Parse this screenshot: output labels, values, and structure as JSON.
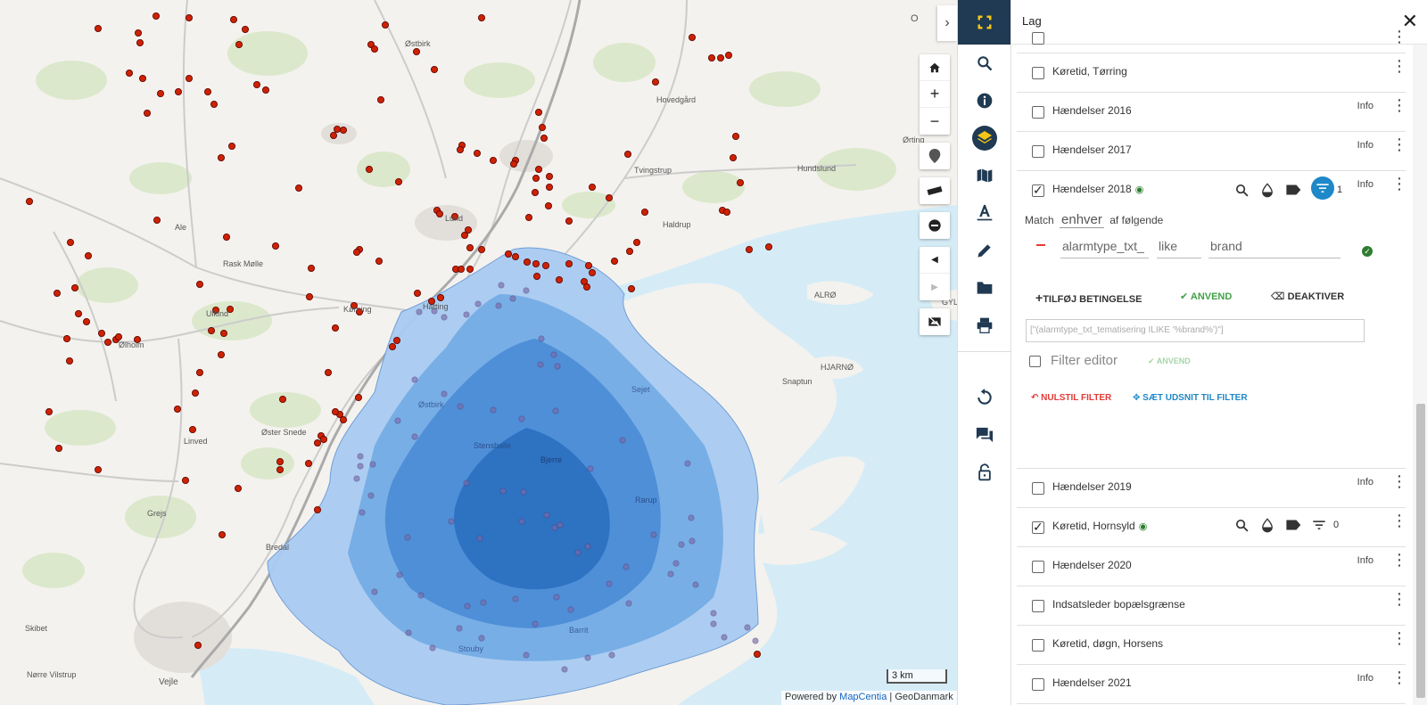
{
  "map": {
    "labels": [
      {
        "text": "Østbirk"
      },
      {
        "text": "Hovedgård"
      },
      {
        "text": "Ørting"
      },
      {
        "text": "Tvingstrup"
      },
      {
        "text": "Hundslund"
      },
      {
        "text": "Ale"
      },
      {
        "text": "Lund"
      },
      {
        "text": "Haldrup"
      },
      {
        "text": "Rask Mølle"
      },
      {
        "text": "Kørning"
      },
      {
        "text": "Hatting"
      },
      {
        "text": "Ulkind"
      },
      {
        "text": "Ølholm"
      },
      {
        "text": "ALRØ"
      },
      {
        "text": "HJARNØ"
      },
      {
        "text": "Snaptun"
      },
      {
        "text": "Linved"
      },
      {
        "text": "Øster Snede"
      },
      {
        "text": "Østbirk"
      },
      {
        "text": "Stensballe"
      },
      {
        "text": "Bjerre"
      },
      {
        "text": "Sejet"
      },
      {
        "text": "Rarup"
      },
      {
        "text": "Grejs"
      },
      {
        "text": "Bredal"
      },
      {
        "text": "Skibet"
      },
      {
        "text": "Vejle"
      },
      {
        "text": "Nørre Vilstrup"
      },
      {
        "text": "Barrit"
      },
      {
        "text": "Stouby"
      },
      {
        "text": "GYL"
      }
    ],
    "scalebar": "3 km",
    "attribution": {
      "prefix": "Powered by",
      "link": "MapCentia",
      "suffix": "| GeoDanmark"
    },
    "controls": {
      "home": "home-icon",
      "zoom_in": "+",
      "zoom_out": "−"
    },
    "colors": {
      "incident": "#cc2200",
      "drive_time_dark": "#2a6fc0",
      "drive_time_light": "#a9ccf2",
      "water": "#d5ecf7"
    }
  },
  "rail": {
    "icons": [
      "fullscreen-icon",
      "search-icon",
      "info-icon",
      "layers-icon",
      "map-icon",
      "text-icon",
      "pencil-icon",
      "folder-icon",
      "print-icon",
      "undo-icon",
      "chat-icon",
      "lock-icon"
    ]
  },
  "panel": {
    "title": "Lag",
    "layers_top": [
      {
        "name": "Køretid, Tørring",
        "info": "",
        "checked": false
      },
      {
        "name": "Hændelser 2016",
        "info": "Info",
        "checked": false
      },
      {
        "name": "Hændelser 2017",
        "info": "Info",
        "checked": false
      }
    ],
    "active_layer": {
      "name": "Hændelser 2018",
      "info": "Info",
      "checked": true,
      "filter_count": "1"
    },
    "filter": {
      "match_prefix": "Match",
      "match_value": "enhver",
      "match_suffix": "af følgende",
      "field": "alarmtype_txt_",
      "operator": "like",
      "value": "brand",
      "add_condition": "TILFØJ BETINGELSE",
      "apply": "ANVEND",
      "deactivate": "DEAKTIVER",
      "sql": "[\"(alarmtype_txt_tematisering ILIKE '%brand%')\"]",
      "filter_editor": "Filter editor",
      "editor_apply": "ANVEND",
      "reset": "NULSTIL FILTER",
      "set_extent": "SÆT UDSNIT TIL FILTER"
    },
    "layers_bottom": [
      {
        "name": "Hændelser 2019",
        "info": "Info",
        "checked": false
      }
    ],
    "hornsyld": {
      "name": "Køretid, Hornsyld",
      "checked": true,
      "filter_count": "0"
    },
    "layers_end": [
      {
        "name": "Hændelser 2020",
        "info": "Info",
        "checked": false
      },
      {
        "name": "Indsatsleder bopælsgrænse",
        "info": "",
        "checked": false
      },
      {
        "name": "Køretid, døgn, Horsens",
        "info": "",
        "checked": false
      },
      {
        "name": "Hændelser 2021",
        "info": "Info",
        "checked": false
      }
    ]
  }
}
